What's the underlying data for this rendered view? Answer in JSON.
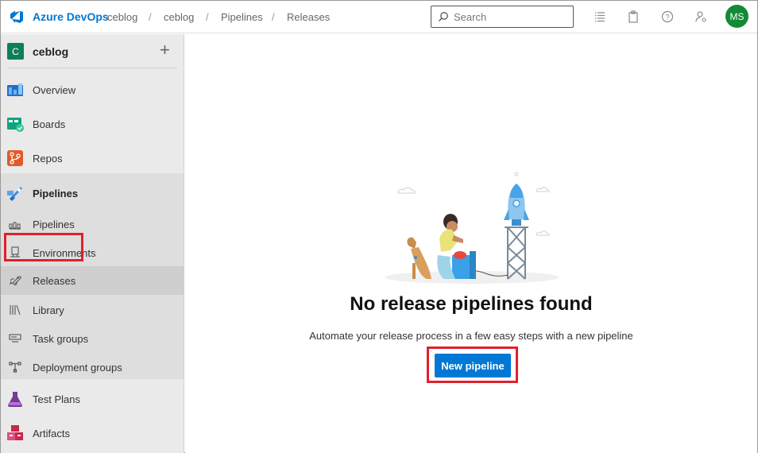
{
  "topbar": {
    "brand": "Azure DevOps",
    "breadcrumbs": [
      "ceblog",
      "ceblog",
      "Pipelines",
      "Releases"
    ],
    "separator": "/",
    "search_placeholder": "Search",
    "user_initials": "MS"
  },
  "sidebar": {
    "project_initial": "C",
    "project_name": "ceblog",
    "add_symbol": "+",
    "items": [
      {
        "label": "Overview",
        "icon": "overview-icon"
      },
      {
        "label": "Boards",
        "icon": "boards-icon"
      },
      {
        "label": "Repos",
        "icon": "repos-icon"
      },
      {
        "label": "Pipelines",
        "icon": "pipelines-icon"
      },
      {
        "label": "Pipelines",
        "icon": "pipelines-sub-icon"
      },
      {
        "label": "Environments",
        "icon": "environments-icon"
      },
      {
        "label": "Releases",
        "icon": "releases-icon"
      },
      {
        "label": "Library",
        "icon": "library-icon"
      },
      {
        "label": "Task groups",
        "icon": "task-groups-icon"
      },
      {
        "label": "Deployment groups",
        "icon": "deployment-groups-icon"
      },
      {
        "label": "Test Plans",
        "icon": "test-plans-icon"
      },
      {
        "label": "Artifacts",
        "icon": "artifacts-icon"
      }
    ]
  },
  "main": {
    "title": "No release pipelines found",
    "description": "Automate your release process in a few easy steps with a new pipeline",
    "button_label": "New pipeline"
  },
  "colors": {
    "accent": "#0078d4",
    "highlight": "#e0202a",
    "avatar": "#138a36",
    "project_badge": "#0f7f56"
  }
}
